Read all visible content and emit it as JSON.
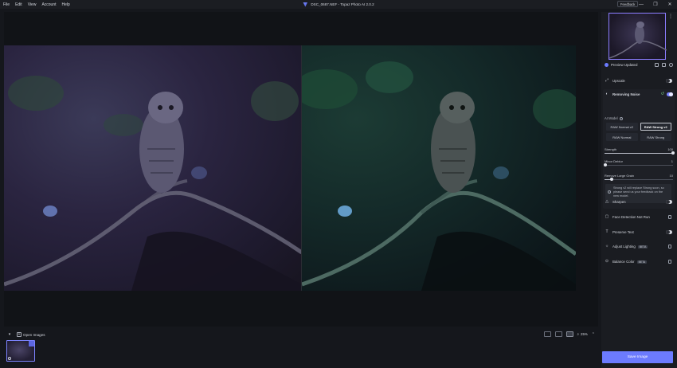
{
  "menu": [
    "File",
    "Edit",
    "View",
    "Account",
    "Help"
  ],
  "window_title": "DSC_0687.NEF - Topaz Photo AI 2.0.2",
  "feedback_label": "Feedback",
  "window_controls": {
    "minimize": "—",
    "maximize": "❐",
    "close": "✕"
  },
  "filmstrip": {
    "open_images_label": "Open Images",
    "zoom": "25%"
  },
  "preview": {
    "status": "Preview Updated"
  },
  "panel": {
    "upscale": "Upscale",
    "removing_noise": "Removing Noise",
    "ai_model_label": "AI Model",
    "models": [
      "RAW Normal v2",
      "RAW Strong v2",
      "RAW Normal",
      "RAW Strong"
    ],
    "selected_model_index": 1,
    "sliders": [
      {
        "label": "Strength",
        "value": "100",
        "fraction": 1.0
      },
      {
        "label": "Minor Deblur",
        "value": "1",
        "fraction": 0.01
      },
      {
        "label": "Remove Large Grain",
        "value": "10",
        "fraction": 0.1
      }
    ],
    "notice": "Strong v2 will replace Strong soon, so please send us your feedback on the new model.",
    "sharpen": "Sharpen",
    "face_detection": "Face Detection Not Run",
    "preserve_text": "Preserve Text",
    "adjust_lighting": "Adjust Lighting",
    "balance_color": "Balance Color",
    "beta_label": "BETA",
    "save_label": "Save Image"
  }
}
